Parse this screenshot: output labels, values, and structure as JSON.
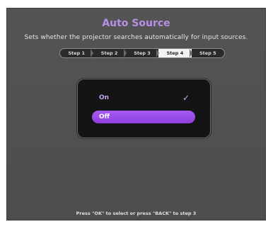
{
  "title": "Auto Source",
  "subtitle": "Sets whether the projector searches automatically for input sources.",
  "steps": [
    {
      "label": "Step 1",
      "active": false
    },
    {
      "label": "Step 2",
      "active": false
    },
    {
      "label": "Step 3",
      "active": false
    },
    {
      "label": "Step 4",
      "active": true
    },
    {
      "label": "Step 5",
      "active": false
    }
  ],
  "options": [
    {
      "label": "On",
      "checked": true,
      "selected": false
    },
    {
      "label": "Off",
      "checked": false,
      "selected": true
    }
  ],
  "check_icon": "checkmark-icon",
  "footer": "Press \"OK\" to select or press \"BACK\" to step 3",
  "colors": {
    "accent": "#b88ee8",
    "selected": "#9a4ce8",
    "background": "#525252",
    "panel": "#141414"
  }
}
